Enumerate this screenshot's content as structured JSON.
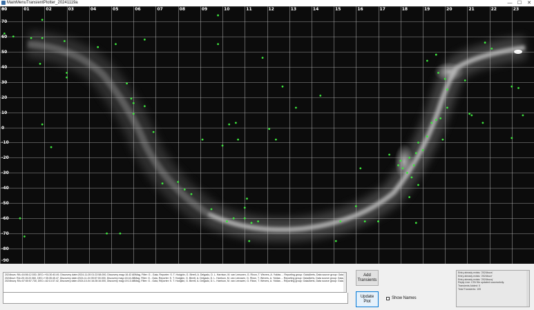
{
  "window": {
    "title": "MainMenuTransientPlotter_20241119a",
    "minimize": "—",
    "maximize": "☐",
    "close": "✕"
  },
  "colors": {
    "marker": "#3de83d",
    "grid": "#bdbdbd",
    "background": "#0c0c0c"
  },
  "map": {
    "ra_labels": [
      "00",
      "01",
      "02",
      "03",
      "04",
      "05",
      "06",
      "07",
      "08",
      "09",
      "10",
      "11",
      "12",
      "13",
      "14",
      "15",
      "16",
      "17",
      "18",
      "19",
      "20",
      "21",
      "22",
      "23"
    ],
    "dec_labels": [
      "80",
      "70",
      "60",
      "50",
      "40",
      "30",
      "20",
      "10",
      "0",
      "-10",
      "-20",
      "-30",
      "-40",
      "-50",
      "-60",
      "-70",
      "-80",
      "-90"
    ],
    "transients": [
      {
        "ra": 0.2,
        "dec": 62
      },
      {
        "ra": 0.6,
        "dec": 60
      },
      {
        "ra": 1.4,
        "dec": 59
      },
      {
        "ra": 1.9,
        "dec": 71
      },
      {
        "ra": 1.9,
        "dec": 59
      },
      {
        "ra": 1.8,
        "dec": 42
      },
      {
        "ra": 2.9,
        "dec": 57
      },
      {
        "ra": 4.4,
        "dec": 53
      },
      {
        "ra": 3.0,
        "dec": 36
      },
      {
        "ra": 3.0,
        "dec": 33
      },
      {
        "ra": 5.2,
        "dec": 55
      },
      {
        "ra": 5.7,
        "dec": 29
      },
      {
        "ra": 5.9,
        "dec": 19
      },
      {
        "ra": 6.0,
        "dec": 16
      },
      {
        "ra": 6.5,
        "dec": 14
      },
      {
        "ra": 6.0,
        "dec": 9
      },
      {
        "ra": 6.9,
        "dec": -3
      },
      {
        "ra": 6.5,
        "dec": 58
      },
      {
        "ra": 1.9,
        "dec": 2
      },
      {
        "ra": 2.3,
        "dec": -13
      },
      {
        "ra": 9.8,
        "dec": 74
      },
      {
        "ra": 9.8,
        "dec": 55
      },
      {
        "ra": 9.1,
        "dec": -8
      },
      {
        "ra": 10.0,
        "dec": -12
      },
      {
        "ra": 10.3,
        "dec": 2
      },
      {
        "ra": 10.6,
        "dec": 3
      },
      {
        "ra": 10.7,
        "dec": -8
      },
      {
        "ra": 11.8,
        "dec": 46
      },
      {
        "ra": 12.1,
        "dec": -1
      },
      {
        "ra": 12.4,
        "dec": -8
      },
      {
        "ra": 12.7,
        "dec": 27
      },
      {
        "ra": 13.3,
        "dec": 13
      },
      {
        "ra": 14.4,
        "dec": 21
      },
      {
        "ra": 15.3,
        "dec": -62
      },
      {
        "ra": 15.1,
        "dec": -75
      },
      {
        "ra": 7.3,
        "dec": -37
      },
      {
        "ra": 8.0,
        "dec": -36
      },
      {
        "ra": 8.3,
        "dec": -41
      },
      {
        "ra": 8.6,
        "dec": -44
      },
      {
        "ra": 9.5,
        "dec": -54
      },
      {
        "ra": 10.2,
        "dec": -62
      },
      {
        "ra": 10.5,
        "dec": -60
      },
      {
        "ra": 11.0,
        "dec": -60
      },
      {
        "ra": 11.1,
        "dec": -47
      },
      {
        "ra": 11.3,
        "dec": -63
      },
      {
        "ra": 11.6,
        "dec": -62
      },
      {
        "ra": 11.0,
        "dec": -53
      },
      {
        "ra": 11.2,
        "dec": -75
      },
      {
        "ra": 0.9,
        "dec": -60
      },
      {
        "ra": 1.1,
        "dec": -72
      },
      {
        "ra": 4.8,
        "dec": -70
      },
      {
        "ra": 5.4,
        "dec": -70
      },
      {
        "ra": 16.0,
        "dec": -52
      },
      {
        "ra": 16.2,
        "dec": -27
      },
      {
        "ra": 16.4,
        "dec": -62
      },
      {
        "ra": 17.0,
        "dec": -62
      },
      {
        "ra": 17.5,
        "dec": -18
      },
      {
        "ra": 17.9,
        "dec": -25
      },
      {
        "ra": 18.0,
        "dec": -22
      },
      {
        "ra": 18.1,
        "dec": -27
      },
      {
        "ra": 18.3,
        "dec": -30
      },
      {
        "ra": 18.4,
        "dec": -20
      },
      {
        "ra": 18.5,
        "dec": -33
      },
      {
        "ra": 18.6,
        "dec": -25
      },
      {
        "ra": 18.4,
        "dec": -46
      },
      {
        "ra": 18.7,
        "dec": -17
      },
      {
        "ra": 18.8,
        "dec": -10
      },
      {
        "ra": 19.0,
        "dec": -15
      },
      {
        "ra": 18.7,
        "dec": -63
      },
      {
        "ra": 19.2,
        "dec": -6
      },
      {
        "ra": 19.4,
        "dec": 3
      },
      {
        "ra": 19.6,
        "dec": 5
      },
      {
        "ra": 19.8,
        "dec": 6
      },
      {
        "ra": 19.9,
        "dec": -8
      },
      {
        "ra": 20.1,
        "dec": 13
      },
      {
        "ra": 19.7,
        "dec": 36
      },
      {
        "ra": 19.2,
        "dec": 44
      },
      {
        "ra": 19.6,
        "dec": 48
      },
      {
        "ra": 20.0,
        "dec": 32
      },
      {
        "ra": 20.1,
        "dec": 25
      },
      {
        "ra": 20.9,
        "dec": 31
      },
      {
        "ra": 21.1,
        "dec": 9
      },
      {
        "ra": 21.2,
        "dec": 8
      },
      {
        "ra": 21.7,
        "dec": 3
      },
      {
        "ra": 21.8,
        "dec": 56
      },
      {
        "ra": 22.1,
        "dec": 52
      },
      {
        "ra": 23.0,
        "dec": 27
      },
      {
        "ra": 23.3,
        "dec": 26
      },
      {
        "ra": 23.5,
        "dec": 8
      },
      {
        "ra": 23.0,
        "dec": -7
      },
      {
        "ra": 18.8,
        "dec": -38
      }
    ]
  },
  "log": {
    "lines": [
      "2024bozs: RA=16:56:12.530, DEC=+51:30:40.49, Discovery date=2024-11-05 01:22:58.000, Discovery mag=16.42 ABMag, Filter: G - Gaia, Reporter: S. T. Hodgkin, G. Birrell, A. Delgado, D. L. Harrison, M. van Leeuwen, G. Rixon, T. Wevers, A. Yoldas ... Reporting group: GaiaAlerts, Data source group: GaiaAlerts",
      "2024bozr: RA=20:15:22.060, DEC=+35:35:45.47, Discovery date=2024-11-04 05:57:00.000, Discovery mag=18.44 ABMag, Filter: G - Gaia, Reporter: S. T. Hodgkin, G. Birrell, A. Delgado, D. L. Harrison, M. van Leeuwen, G. Rixon, T. Wevers, A. Yoldas ... Reporting group: GaiaAlerts, Data source group: GaiaAlerts",
      "2024bozq: RA=07:50:57.730, DEC=-62:13:37.42, Discovery date=2024-10-04 16:28:16.000, Discovery mag=19.13 ABMag, Filter: G - Gaia, Reporter: S. T. Hodgkin, G. Birrell, A. Delgado, D. L. Harrison, M. van Leeuwen, G. Rixon, T. Wevers, A. Yoldas ... Reporting group: GaiaAlerts, Data source group: GaiaAlerts"
    ]
  },
  "buttons": {
    "add_transients": "Add Transients",
    "update_plot": "Update Plot"
  },
  "checkbox": {
    "show_names_label": "Show Names",
    "checked": false
  },
  "status": {
    "lines": [
      "Entry already exists: '2024bozs'",
      "Entry already exists: '2024bozr'",
      "Entry already exists: '2024bozq'",
      "Reply Line: CSV file updated successfully.",
      "Transients Added: 0",
      "Total Transients: 105"
    ]
  }
}
